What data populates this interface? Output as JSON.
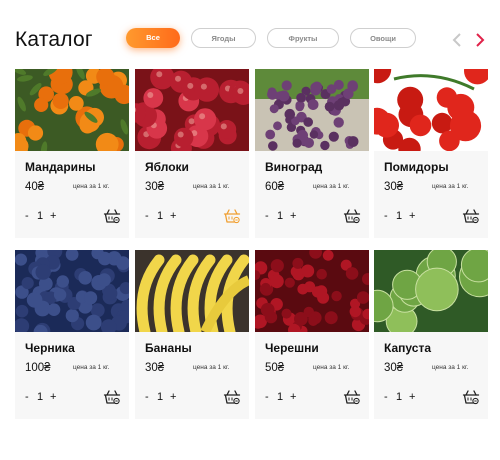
{
  "header": {
    "title": "Каталог",
    "filters": [
      "Все",
      "Ягоды",
      "Фрукты",
      "Овощи"
    ],
    "active_filter": "Все",
    "prev_icon": "chevron-left-icon",
    "next_icon": "chevron-right-icon"
  },
  "colors": {
    "accent": "#ff7a22",
    "active_arrow": "#e0234a",
    "inactive_arrow": "#c8c8c8",
    "cart_active": "#f0a032",
    "card_bg": "#f7f7f7"
  },
  "stepper": {
    "minus": "-",
    "plus": "+"
  },
  "products": [
    {
      "name": "Мандарины",
      "price": "40₴",
      "unit": "цена за 1 кг.",
      "qty": "1",
      "cart_icon": "basket-icon"
    },
    {
      "name": "Яблоки",
      "price": "30₴",
      "unit": "цена за 1 кг.",
      "qty": "1",
      "cart_icon": "basket-icon",
      "in_cart": true
    },
    {
      "name": "Виноград",
      "price": "60₴",
      "unit": "цена за 1 кг.",
      "qty": "1",
      "cart_icon": "basket-icon"
    },
    {
      "name": "Помидоры",
      "price": "30₴",
      "unit": "цена за 1 кг.",
      "qty": "1",
      "cart_icon": "basket-icon"
    },
    {
      "name": "Черника",
      "price": "100₴",
      "unit": "цена за 1 кг.",
      "qty": "1",
      "cart_icon": "basket-icon"
    },
    {
      "name": "Бананы",
      "price": "30₴",
      "unit": "цена за 1 кг.",
      "qty": "1",
      "cart_icon": "basket-icon"
    },
    {
      "name": "Черешни",
      "price": "50₴",
      "unit": "цена за 1 кг.",
      "qty": "1",
      "cart_icon": "basket-icon"
    },
    {
      "name": "Капуста",
      "price": "30₴",
      "unit": "цена за 1 кг.",
      "qty": "1",
      "cart_icon": "basket-icon"
    }
  ]
}
